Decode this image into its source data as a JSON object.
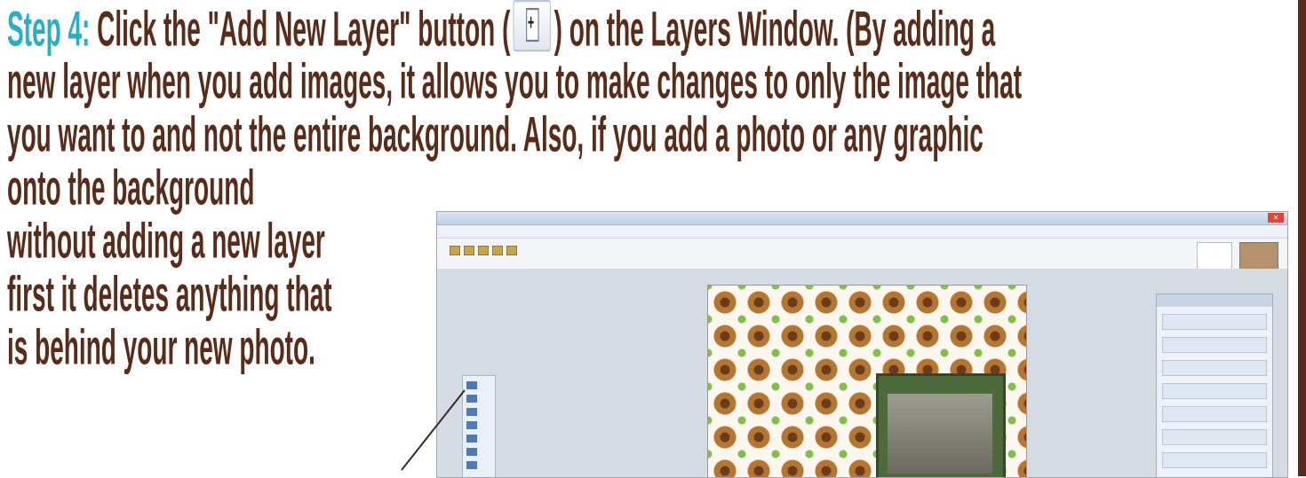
{
  "instructions": {
    "step_label": "Step 4:",
    "line1_before_button": " Click the \"Add New Layer\" button (",
    "line1_after_button": ") on the Layers Window. (By adding a",
    "line2": "new layer when you add images, it allows you to make changes to only the image that",
    "line3": "you want to and not the entire background. Also, if you add a photo or any graphic",
    "line4": "onto the background",
    "line5": "without adding a new layer",
    "line6": "first it deletes anything that",
    "line7": "is behind your new photo."
  },
  "icons": {
    "inline_button": "add-new-layer-icon"
  },
  "colors": {
    "text": "#5a2b18",
    "step_label": "#2aaec6",
    "rule": "#5a2b18"
  }
}
